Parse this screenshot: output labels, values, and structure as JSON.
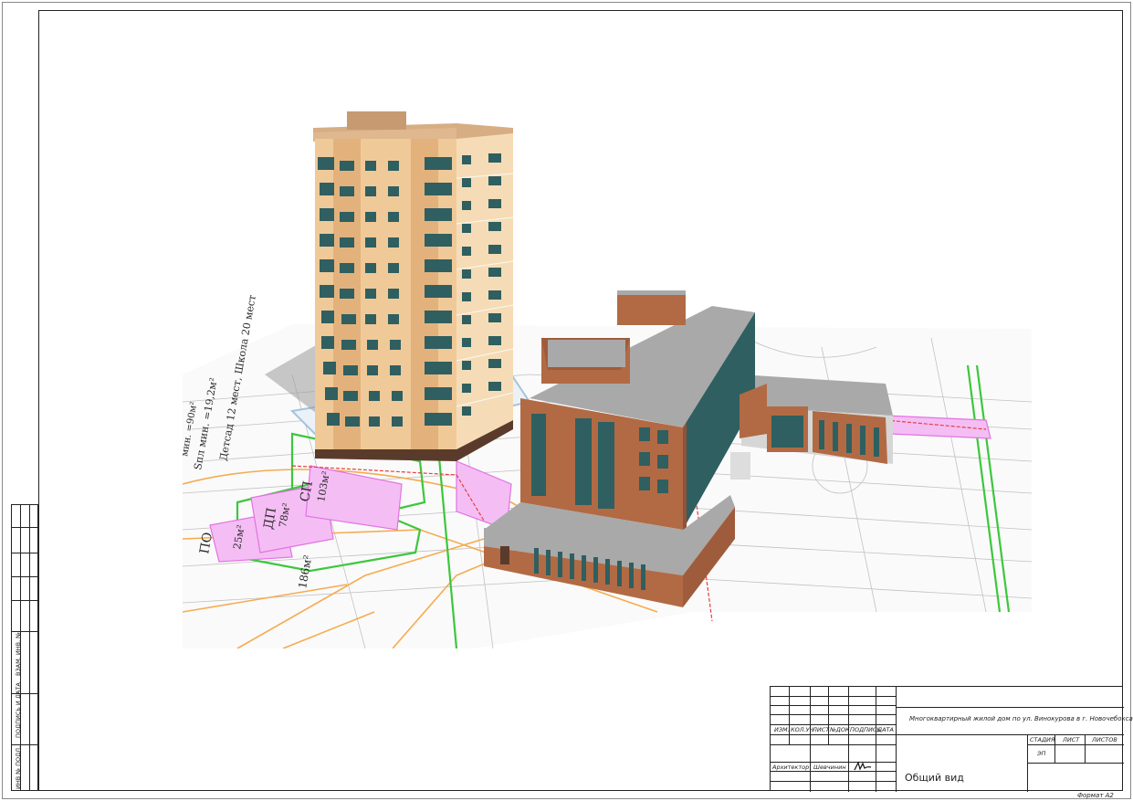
{
  "side_stamp": {
    "labels": [
      "ИНВ № ПОДЛ.",
      "ПОДПИСЬ И ДАТА",
      "ВЗАМ. ИНВ. №"
    ]
  },
  "drawing": {
    "plan_labels": [
      "СП",
      "ДП",
      "ПО",
      "103м²",
      "78м²",
      "25м²",
      "186м²",
      "Sпл мин. =19,2м²",
      "Детсад 12 мест, Школа 20 мест",
      "мин. =90м²"
    ]
  },
  "title_block": {
    "column_headers": [
      "ИЗМ.",
      "КОЛ.УЧ",
      "ЛИСТ",
      "№ДОК",
      "ПОДПИСЬ",
      "ДАТА"
    ],
    "project_name": "Многоквартирный жилой дом по ул. Винокурова в г. Новочебоксарск .",
    "stage_header": "СТАДИЯ",
    "sheet_header": "ЛИСТ",
    "sheets_header": "ЛИСТОВ",
    "stage_value": "ЭП",
    "role": "Архитектор",
    "person": "Шевчинин",
    "sheet_title": "Общий вид"
  },
  "format": "Формат А2",
  "colors": {
    "tower_facade": "#f0c998",
    "tower_accent": "#e3b27c",
    "glazing": "#2f5f60",
    "brick": "#b26a44",
    "roof": "#a9a9a9",
    "plan_green": "#27c227",
    "plan_orange": "#f5a33c",
    "plan_magenta": "#e063e0",
    "plan_red": "#e62a2a"
  }
}
